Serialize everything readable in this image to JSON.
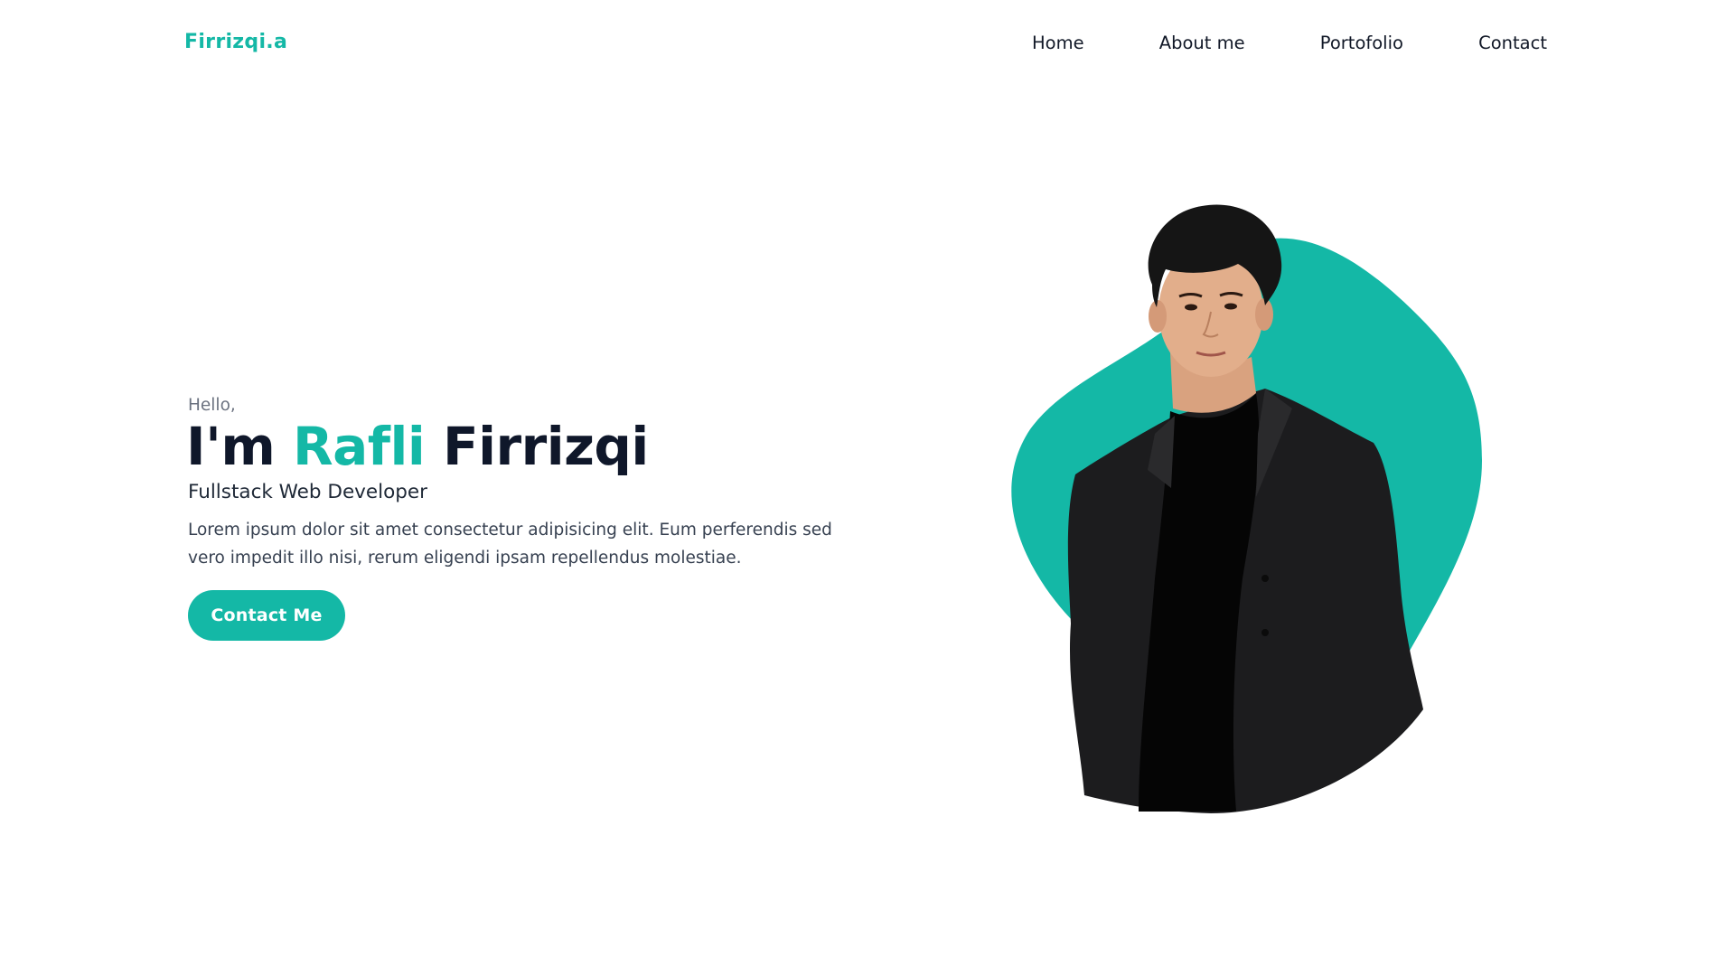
{
  "nav": {
    "brand": "Firrizqi.a",
    "links": [
      {
        "label": "Home"
      },
      {
        "label": "About me"
      },
      {
        "label": "Portofolio"
      },
      {
        "label": "Contact"
      }
    ]
  },
  "hero": {
    "greeting": "Hello,",
    "headline_prefix": "I'm",
    "headline_accent": "Rafli",
    "headline_suffix": "Firrizqi",
    "role": "Fullstack Web Developer",
    "description": "Lorem ipsum dolor sit amet consectetur adipisicing elit. Eum perferendis sed vero impedit illo nisi, rerum eligendi ipsam repellendus molestiae.",
    "cta_label": "Contact Me"
  },
  "portrait": {
    "icon": "person-portrait",
    "blob_color": "#14b8a6"
  },
  "colors": {
    "accent": "#14b8a6",
    "text_dark": "#0f172a",
    "text_muted": "#6b7280",
    "background": "#ffffff"
  }
}
